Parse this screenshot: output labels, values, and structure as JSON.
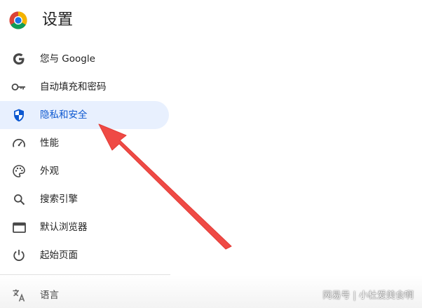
{
  "header": {
    "title": "设置",
    "logo_icon": "chrome-logo-icon"
  },
  "sidebar": {
    "items": [
      {
        "label": "您与 Google",
        "icon": "google-g-icon"
      },
      {
        "label": "自动填充和密码",
        "icon": "key-icon"
      },
      {
        "label": "隐私和安全",
        "icon": "shield-icon",
        "active": true
      },
      {
        "label": "性能",
        "icon": "speedometer-icon"
      },
      {
        "label": "外观",
        "icon": "palette-icon"
      },
      {
        "label": "搜索引擎",
        "icon": "search-icon"
      },
      {
        "label": "默认浏览器",
        "icon": "browser-window-icon"
      },
      {
        "label": "起始页面",
        "icon": "power-icon"
      }
    ],
    "language": {
      "label": "语言",
      "icon": "translate-icon"
    }
  },
  "watermark": {
    "text": "网易号 | 小杜爱美食啊"
  },
  "colors": {
    "active_bg": "#e8f0fe",
    "active_text": "#0b57d0",
    "icon": "#474747",
    "arrow": "#ef4a45"
  }
}
